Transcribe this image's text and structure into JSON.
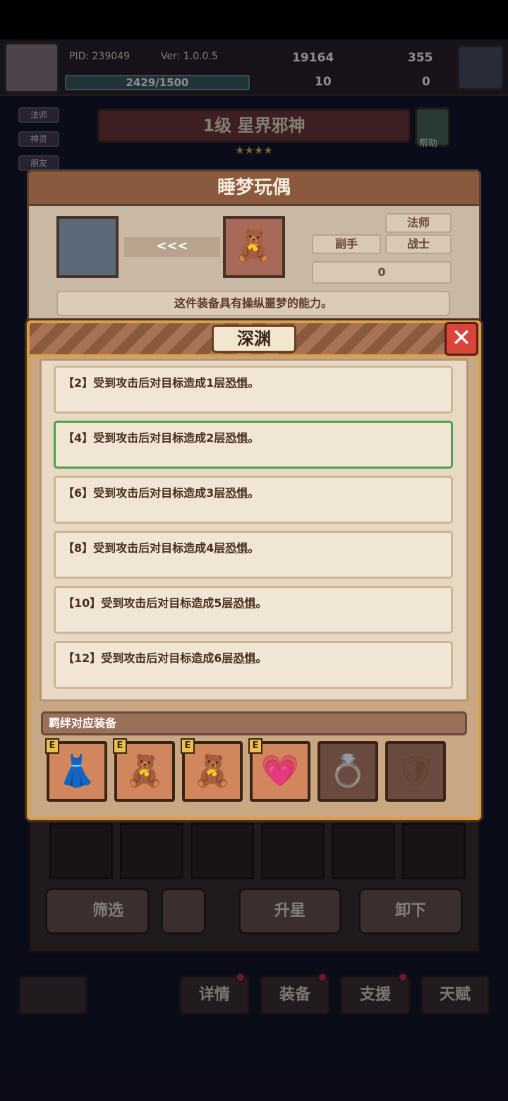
{
  "topbar": {
    "pid": "PID: 239049",
    "version": "Ver: 1.0.0.5",
    "exp": "2429/1500",
    "gold": "19164",
    "gems": "355",
    "res_a": "10",
    "res_b": "0"
  },
  "side_tabs": [
    "法师",
    "神灵",
    "朋友"
  ],
  "character": {
    "title": "1级 星界邪神",
    "stars": "★★★★",
    "help_label": "帮助"
  },
  "item": {
    "name": "睡梦玩偶",
    "arrows": "<<<",
    "tags": [
      "法师",
      "副手",
      "战士"
    ],
    "count": "0",
    "description": "这件装备具有操纵噩梦的能力。"
  },
  "modal": {
    "title": "深渊",
    "close_icon": "close-x-icon",
    "entries": [
      {
        "prefix": "【2】受到攻击后对目标造成1层",
        "keyword": "恐惧",
        "suffix": "。"
      },
      {
        "prefix": "【4】受到攻击后对目标造成2层",
        "keyword": "恐惧",
        "suffix": "。"
      },
      {
        "prefix": "【6】受到攻击后对目标造成3层",
        "keyword": "恐惧",
        "suffix": "。"
      },
      {
        "prefix": "【8】受到攻击后对目标造成4层",
        "keyword": "恐惧",
        "suffix": "。"
      },
      {
        "prefix": "【10】受到攻击后对目标造成5层",
        "keyword": "恐惧",
        "suffix": "。"
      },
      {
        "prefix": "【12】受到攻击后对目标造成6层",
        "keyword": "恐惧",
        "suffix": "。"
      }
    ],
    "active_entry": 1,
    "bond_label": "羁绊对应装备",
    "bond_items": [
      {
        "icon": "pink-dress-icon",
        "glyph": "👗",
        "owned": true,
        "badge": "E"
      },
      {
        "icon": "bear-hood-icon",
        "glyph": "🧸",
        "owned": true,
        "badge": "E"
      },
      {
        "icon": "teddy-bear-icon",
        "glyph": "🧸",
        "owned": true,
        "badge": "E"
      },
      {
        "icon": "heart-necklace-icon",
        "glyph": "💗",
        "owned": true,
        "badge": "E"
      },
      {
        "icon": "heart-ring-icon",
        "glyph": "💍",
        "owned": false,
        "badge": ""
      },
      {
        "icon": "heart-shield-icon",
        "glyph": "🛡",
        "owned": false,
        "badge": ""
      }
    ]
  },
  "bottom": {
    "filter_label": "筛选",
    "upgrade_label": "升星",
    "unequip_label": "卸下",
    "nav": [
      "详情",
      "装备",
      "支援",
      "天赋"
    ]
  },
  "colors": {
    "active_border": "#4ba24a",
    "close_button": "#d8453a",
    "modal_border": "#d9a04a"
  }
}
